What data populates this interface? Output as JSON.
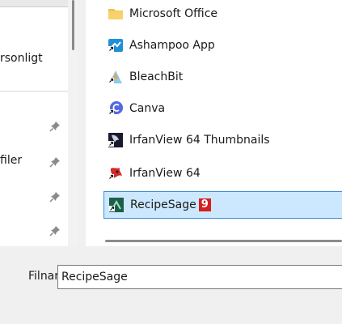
{
  "left_nav": {
    "items": [
      {
        "label": "rsonligt",
        "pinned": false
      },
      {
        "label": "",
        "pinned": true
      },
      {
        "label": "filer",
        "pinned": true
      },
      {
        "label": "",
        "pinned": true
      },
      {
        "label": "",
        "pinned": true
      }
    ]
  },
  "file_list": {
    "items": [
      {
        "label": "Microsoft Office",
        "icon": "folder-icon"
      },
      {
        "label": "Ashampoo App",
        "icon": "ashampoo-shortcut-icon"
      },
      {
        "label": "BleachBit",
        "icon": "bleachbit-shortcut-icon"
      },
      {
        "label": "Canva",
        "icon": "canva-shortcut-icon"
      },
      {
        "label": "IrfanView 64 Thumbnails",
        "icon": "irfanview-thumbnails-shortcut-icon"
      },
      {
        "label": "IrfanView 64",
        "icon": "irfanview-shortcut-icon"
      },
      {
        "label": "RecipeSage",
        "icon": "recipesage-shortcut-icon",
        "selected": true,
        "badge": "9"
      }
    ]
  },
  "filename": {
    "label": "Filnamn:",
    "value": "RecipeSage"
  },
  "colors": {
    "selection_bg": "#cce8ff",
    "selection_border": "#3d8fd6",
    "badge": "#d42020"
  }
}
